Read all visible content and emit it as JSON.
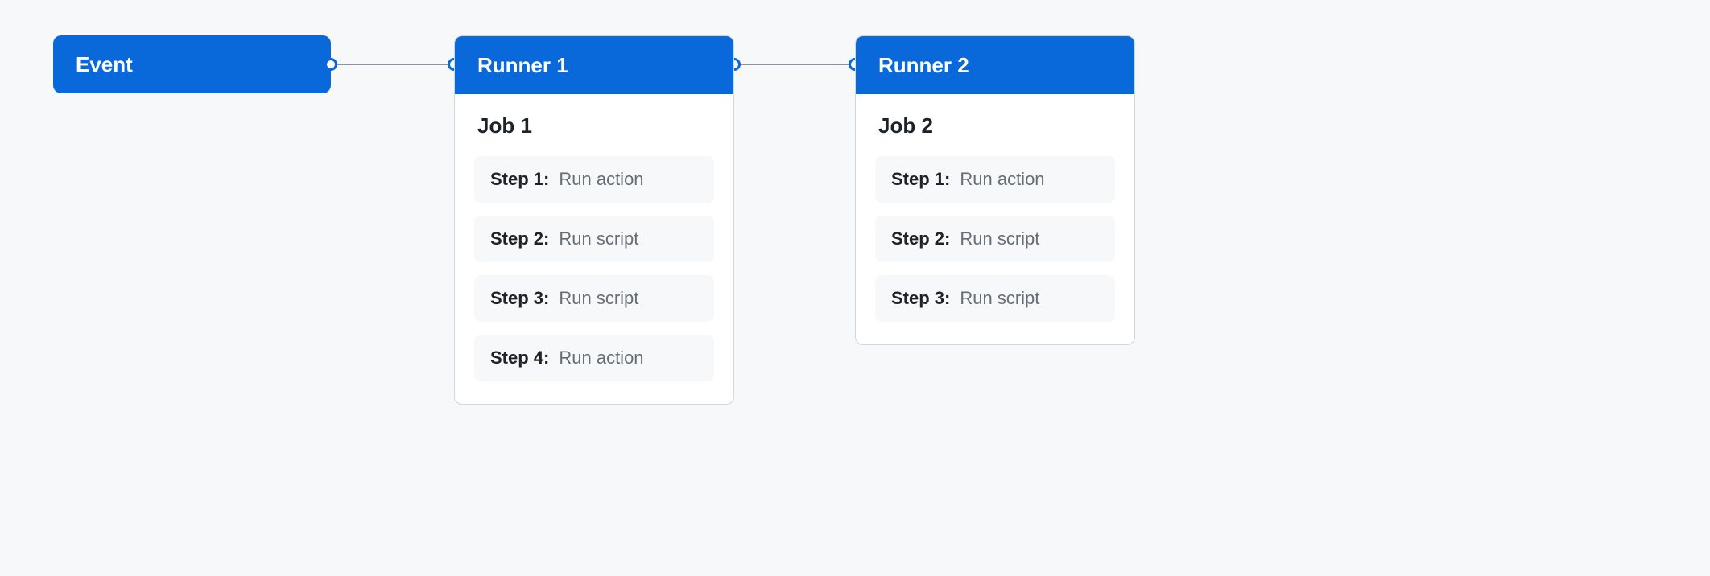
{
  "event": {
    "label": "Event"
  },
  "runners": [
    {
      "header": "Runner 1",
      "job": {
        "title": "Job 1",
        "steps": [
          {
            "label": "Step 1:",
            "desc": "Run action"
          },
          {
            "label": "Step 2:",
            "desc": "Run script"
          },
          {
            "label": "Step 3:",
            "desc": "Run script"
          },
          {
            "label": "Step 4:",
            "desc": "Run action"
          }
        ]
      }
    },
    {
      "header": "Runner 2",
      "job": {
        "title": "Job 2",
        "steps": [
          {
            "label": "Step 1:",
            "desc": "Run action"
          },
          {
            "label": "Step 2:",
            "desc": "Run script"
          },
          {
            "label": "Step 3:",
            "desc": "Run script"
          }
        ]
      }
    }
  ]
}
